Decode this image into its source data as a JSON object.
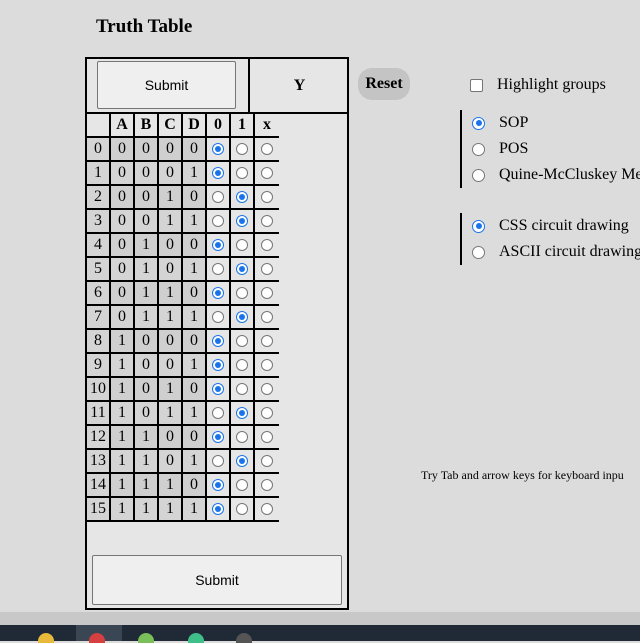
{
  "title": "Truth Table",
  "submit_label": "Submit",
  "output_header": "Y",
  "reset_label": "Reset",
  "columns": [
    "A",
    "B",
    "C",
    "D",
    "0",
    "1",
    "x"
  ],
  "rows": [
    {
      "index": "0",
      "inputs": [
        "0",
        "0",
        "0",
        "0"
      ],
      "output": "0"
    },
    {
      "index": "1",
      "inputs": [
        "0",
        "0",
        "0",
        "1"
      ],
      "output": "0"
    },
    {
      "index": "2",
      "inputs": [
        "0",
        "0",
        "1",
        "0"
      ],
      "output": "1"
    },
    {
      "index": "3",
      "inputs": [
        "0",
        "0",
        "1",
        "1"
      ],
      "output": "1"
    },
    {
      "index": "4",
      "inputs": [
        "0",
        "1",
        "0",
        "0"
      ],
      "output": "0"
    },
    {
      "index": "5",
      "inputs": [
        "0",
        "1",
        "0",
        "1"
      ],
      "output": "1"
    },
    {
      "index": "6",
      "inputs": [
        "0",
        "1",
        "1",
        "0"
      ],
      "output": "0"
    },
    {
      "index": "7",
      "inputs": [
        "0",
        "1",
        "1",
        "1"
      ],
      "output": "1"
    },
    {
      "index": "8",
      "inputs": [
        "1",
        "0",
        "0",
        "0"
      ],
      "output": "0"
    },
    {
      "index": "9",
      "inputs": [
        "1",
        "0",
        "0",
        "1"
      ],
      "output": "0"
    },
    {
      "index": "10",
      "inputs": [
        "1",
        "0",
        "1",
        "0"
      ],
      "output": "0"
    },
    {
      "index": "11",
      "inputs": [
        "1",
        "0",
        "1",
        "1"
      ],
      "output": "1"
    },
    {
      "index": "12",
      "inputs": [
        "1",
        "1",
        "0",
        "0"
      ],
      "output": "0"
    },
    {
      "index": "13",
      "inputs": [
        "1",
        "1",
        "0",
        "1"
      ],
      "output": "1"
    },
    {
      "index": "14",
      "inputs": [
        "1",
        "1",
        "1",
        "0"
      ],
      "output": "0"
    },
    {
      "index": "15",
      "inputs": [
        "1",
        "1",
        "1",
        "1"
      ],
      "output": "0"
    }
  ],
  "highlight_groups": {
    "label": "Highlight groups",
    "checked": false
  },
  "method_options": [
    {
      "label": "SOP",
      "selected": true
    },
    {
      "label": "POS",
      "selected": false
    },
    {
      "label": "Quine-McCluskey Me",
      "selected": false
    }
  ],
  "drawing_options": [
    {
      "label": "CSS circuit drawing",
      "selected": true
    },
    {
      "label": "ASCII circuit drawing",
      "selected": false
    }
  ],
  "hint": "Try Tab and arrow keys for keyboard inpu",
  "colors": {
    "accent": "#1a73e8",
    "background": "#dcdcdc",
    "reset_bg": "#c4c4c4"
  }
}
